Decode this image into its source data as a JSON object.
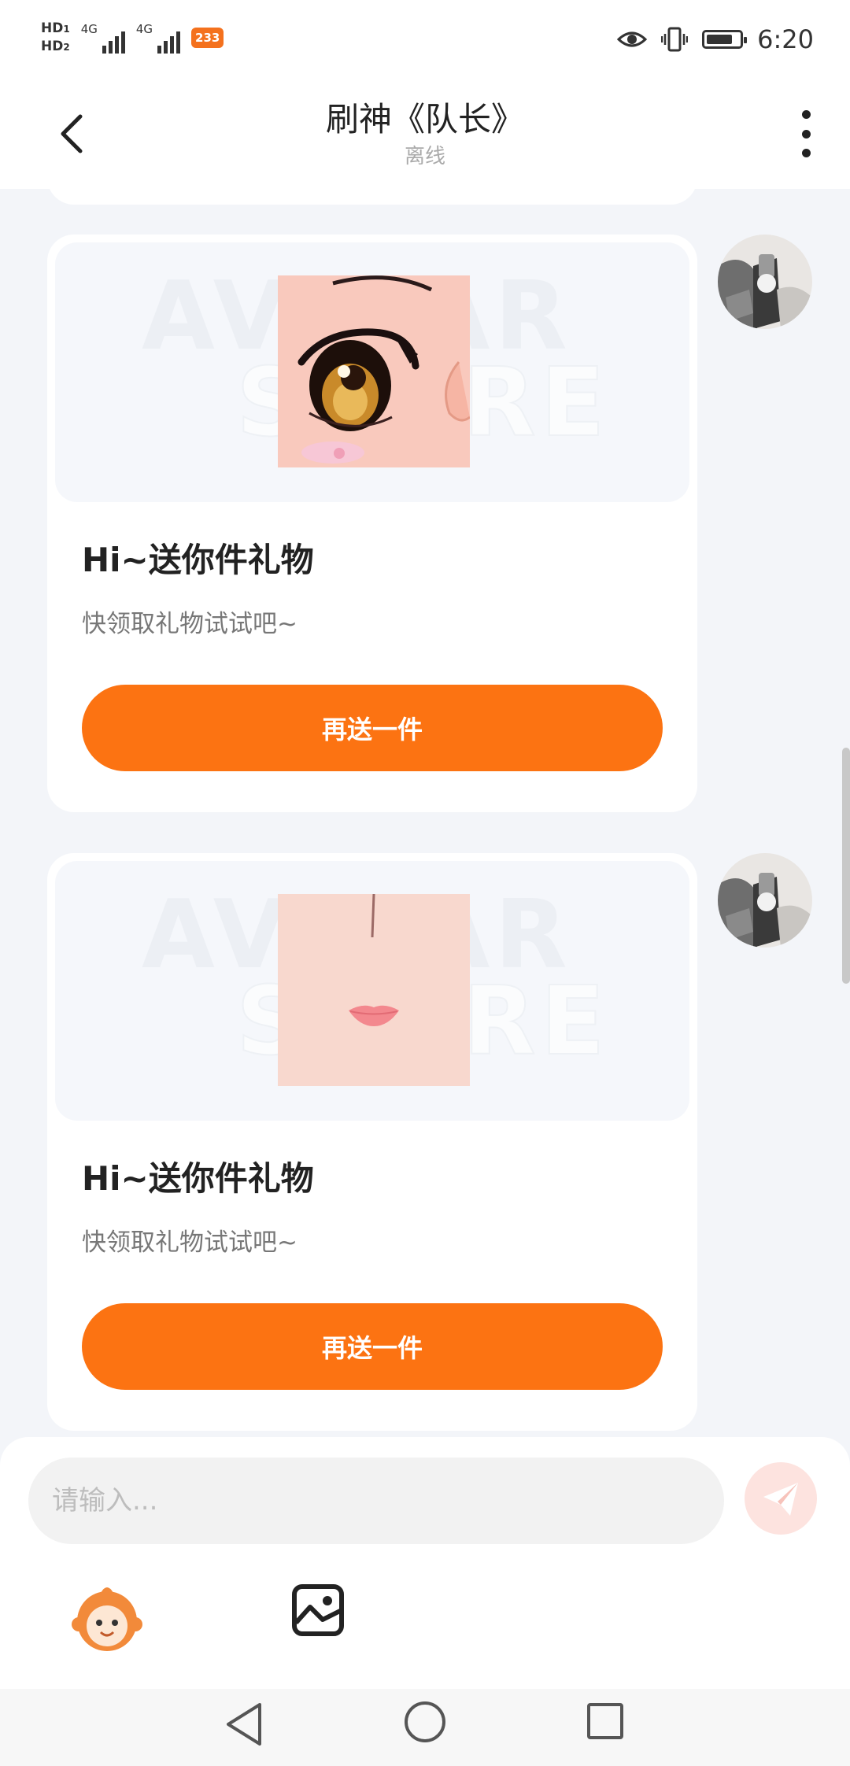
{
  "status_bar": {
    "hd1": "HD",
    "hd1_sub": "1",
    "hd2": "HD",
    "hd2_sub": "2",
    "net1": "4G",
    "net2": "4G",
    "badge": "233",
    "time": "6:20",
    "icons": [
      "eye-icon",
      "vibrate-icon",
      "battery-icon"
    ]
  },
  "header": {
    "title": "刷神《队长》",
    "status": "离线",
    "back_icon": "chevron-left-icon",
    "more_icon": "more-vertical-icon"
  },
  "messages": [
    {
      "title": "Hi~送你件礼物",
      "subtitle": "快领取礼物试试吧~",
      "button": "再送一件",
      "image": "anime-eye-image",
      "watermark": [
        "AVATAR",
        "STORE"
      ]
    },
    {
      "title": "Hi~送你件礼物",
      "subtitle": "快领取礼物试试吧~",
      "button": "再送一件",
      "image": "anime-mouth-image",
      "watermark": [
        "AVATAR",
        "STORE"
      ]
    }
  ],
  "input": {
    "placeholder": "请输入...",
    "value": ""
  },
  "toolbar": {
    "icons": [
      "mascot-emoji-icon",
      "image-icon",
      "send-icon"
    ]
  },
  "colors": {
    "accent": "#fc7312",
    "background": "#f3f5f9",
    "card": "#ffffff",
    "send_disabled": "#fde3df"
  }
}
